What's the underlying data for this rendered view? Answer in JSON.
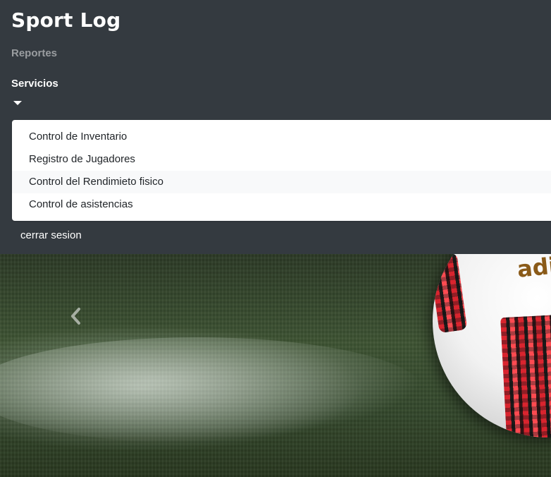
{
  "navbar": {
    "brand": "Sport Log",
    "links": {
      "reportes": "Reportes",
      "servicios": "Servicios"
    },
    "dropdown_items": [
      "Control de Inventario",
      "Registro de Jugadores",
      "Control del Rendimieto fisico",
      "Control de asistencias"
    ],
    "hovered_item_index": 2,
    "logout": "cerrar sesion"
  },
  "hero": {
    "image_brand_text": "adi"
  },
  "icons": {
    "dropdown_caret": "caret-down-icon",
    "carousel_prev": "chevron-left-icon"
  },
  "colors": {
    "navbar_bg": "#343a40",
    "muted_link": "#9a9da0",
    "dropdown_hover": "#f8f9fa"
  }
}
